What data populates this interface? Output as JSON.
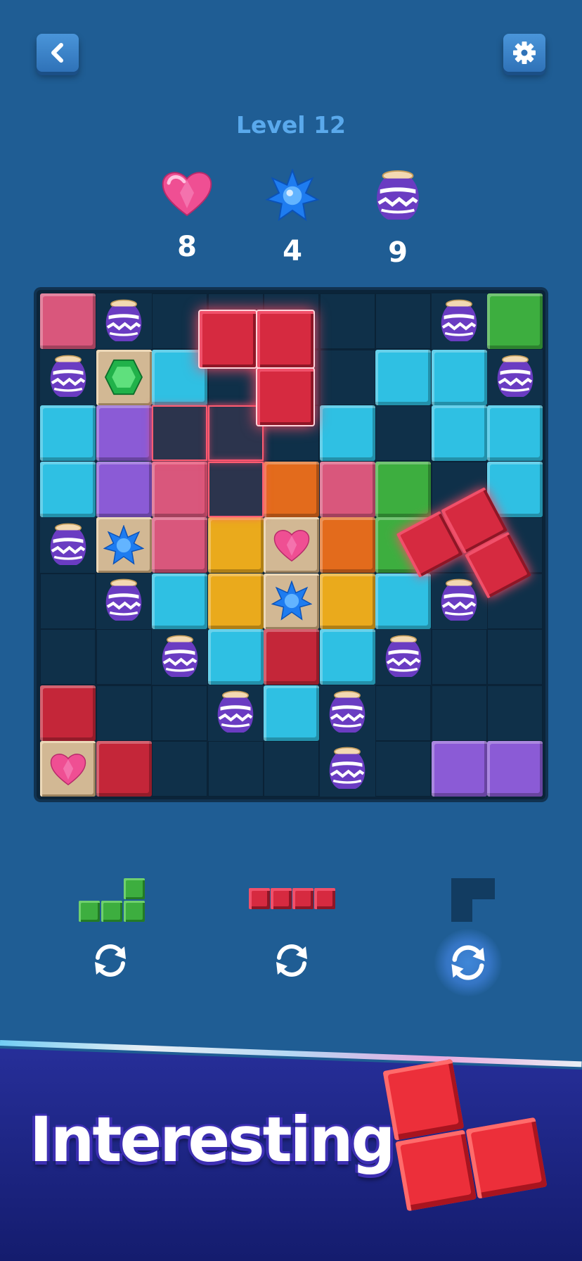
{
  "header": {
    "back_icon": "chevron-left-icon",
    "settings_icon": "gear-icon",
    "level_label": "Level 12"
  },
  "goals": [
    {
      "icon": "heart-gem-icon",
      "count": "8"
    },
    {
      "icon": "blue-star-gem-icon",
      "count": "4"
    },
    {
      "icon": "vase-icon",
      "count": "9"
    }
  ],
  "colors": {
    "pink": "#d9577c",
    "purple": "#8b5bd6",
    "cyan": "#2fc0e3",
    "green": "#3dae3f",
    "red": "#c42639",
    "orange": "#e36b1c",
    "yellow": "#eaaa1c",
    "background": "#1f5d94",
    "board": "#0b2439"
  },
  "board": {
    "size": 9,
    "legend": {
      ".": "empty",
      "P": "pink",
      "U": "purple",
      "C": "cyan",
      "G": "green",
      "R": "red",
      "O": "orange",
      "Y": "yellow",
      "V": "vase",
      "E": "emerald-tile",
      "S": "blue-star-tile",
      "H": "heart-tile"
    },
    "rows": [
      "PV.....VG",
      "VEC...CCV",
      "CU...C.CC",
      "CUP.OPG.C",
      "VSPYHOG..",
      ".VCYSYCV.",
      "..VCRCV..",
      "R..VCV...",
      "HR...V.UU"
    ]
  },
  "tray": {
    "pieces": [
      {
        "name": "green-l-piece",
        "color": "#3dae3f"
      },
      {
        "name": "red-i-piece",
        "color": "#c42639"
      },
      {
        "name": "dark-corner-piece",
        "color": "#123c61"
      }
    ],
    "rotate_icon": "rotate-icon"
  },
  "banner": {
    "title": "Interesting"
  }
}
